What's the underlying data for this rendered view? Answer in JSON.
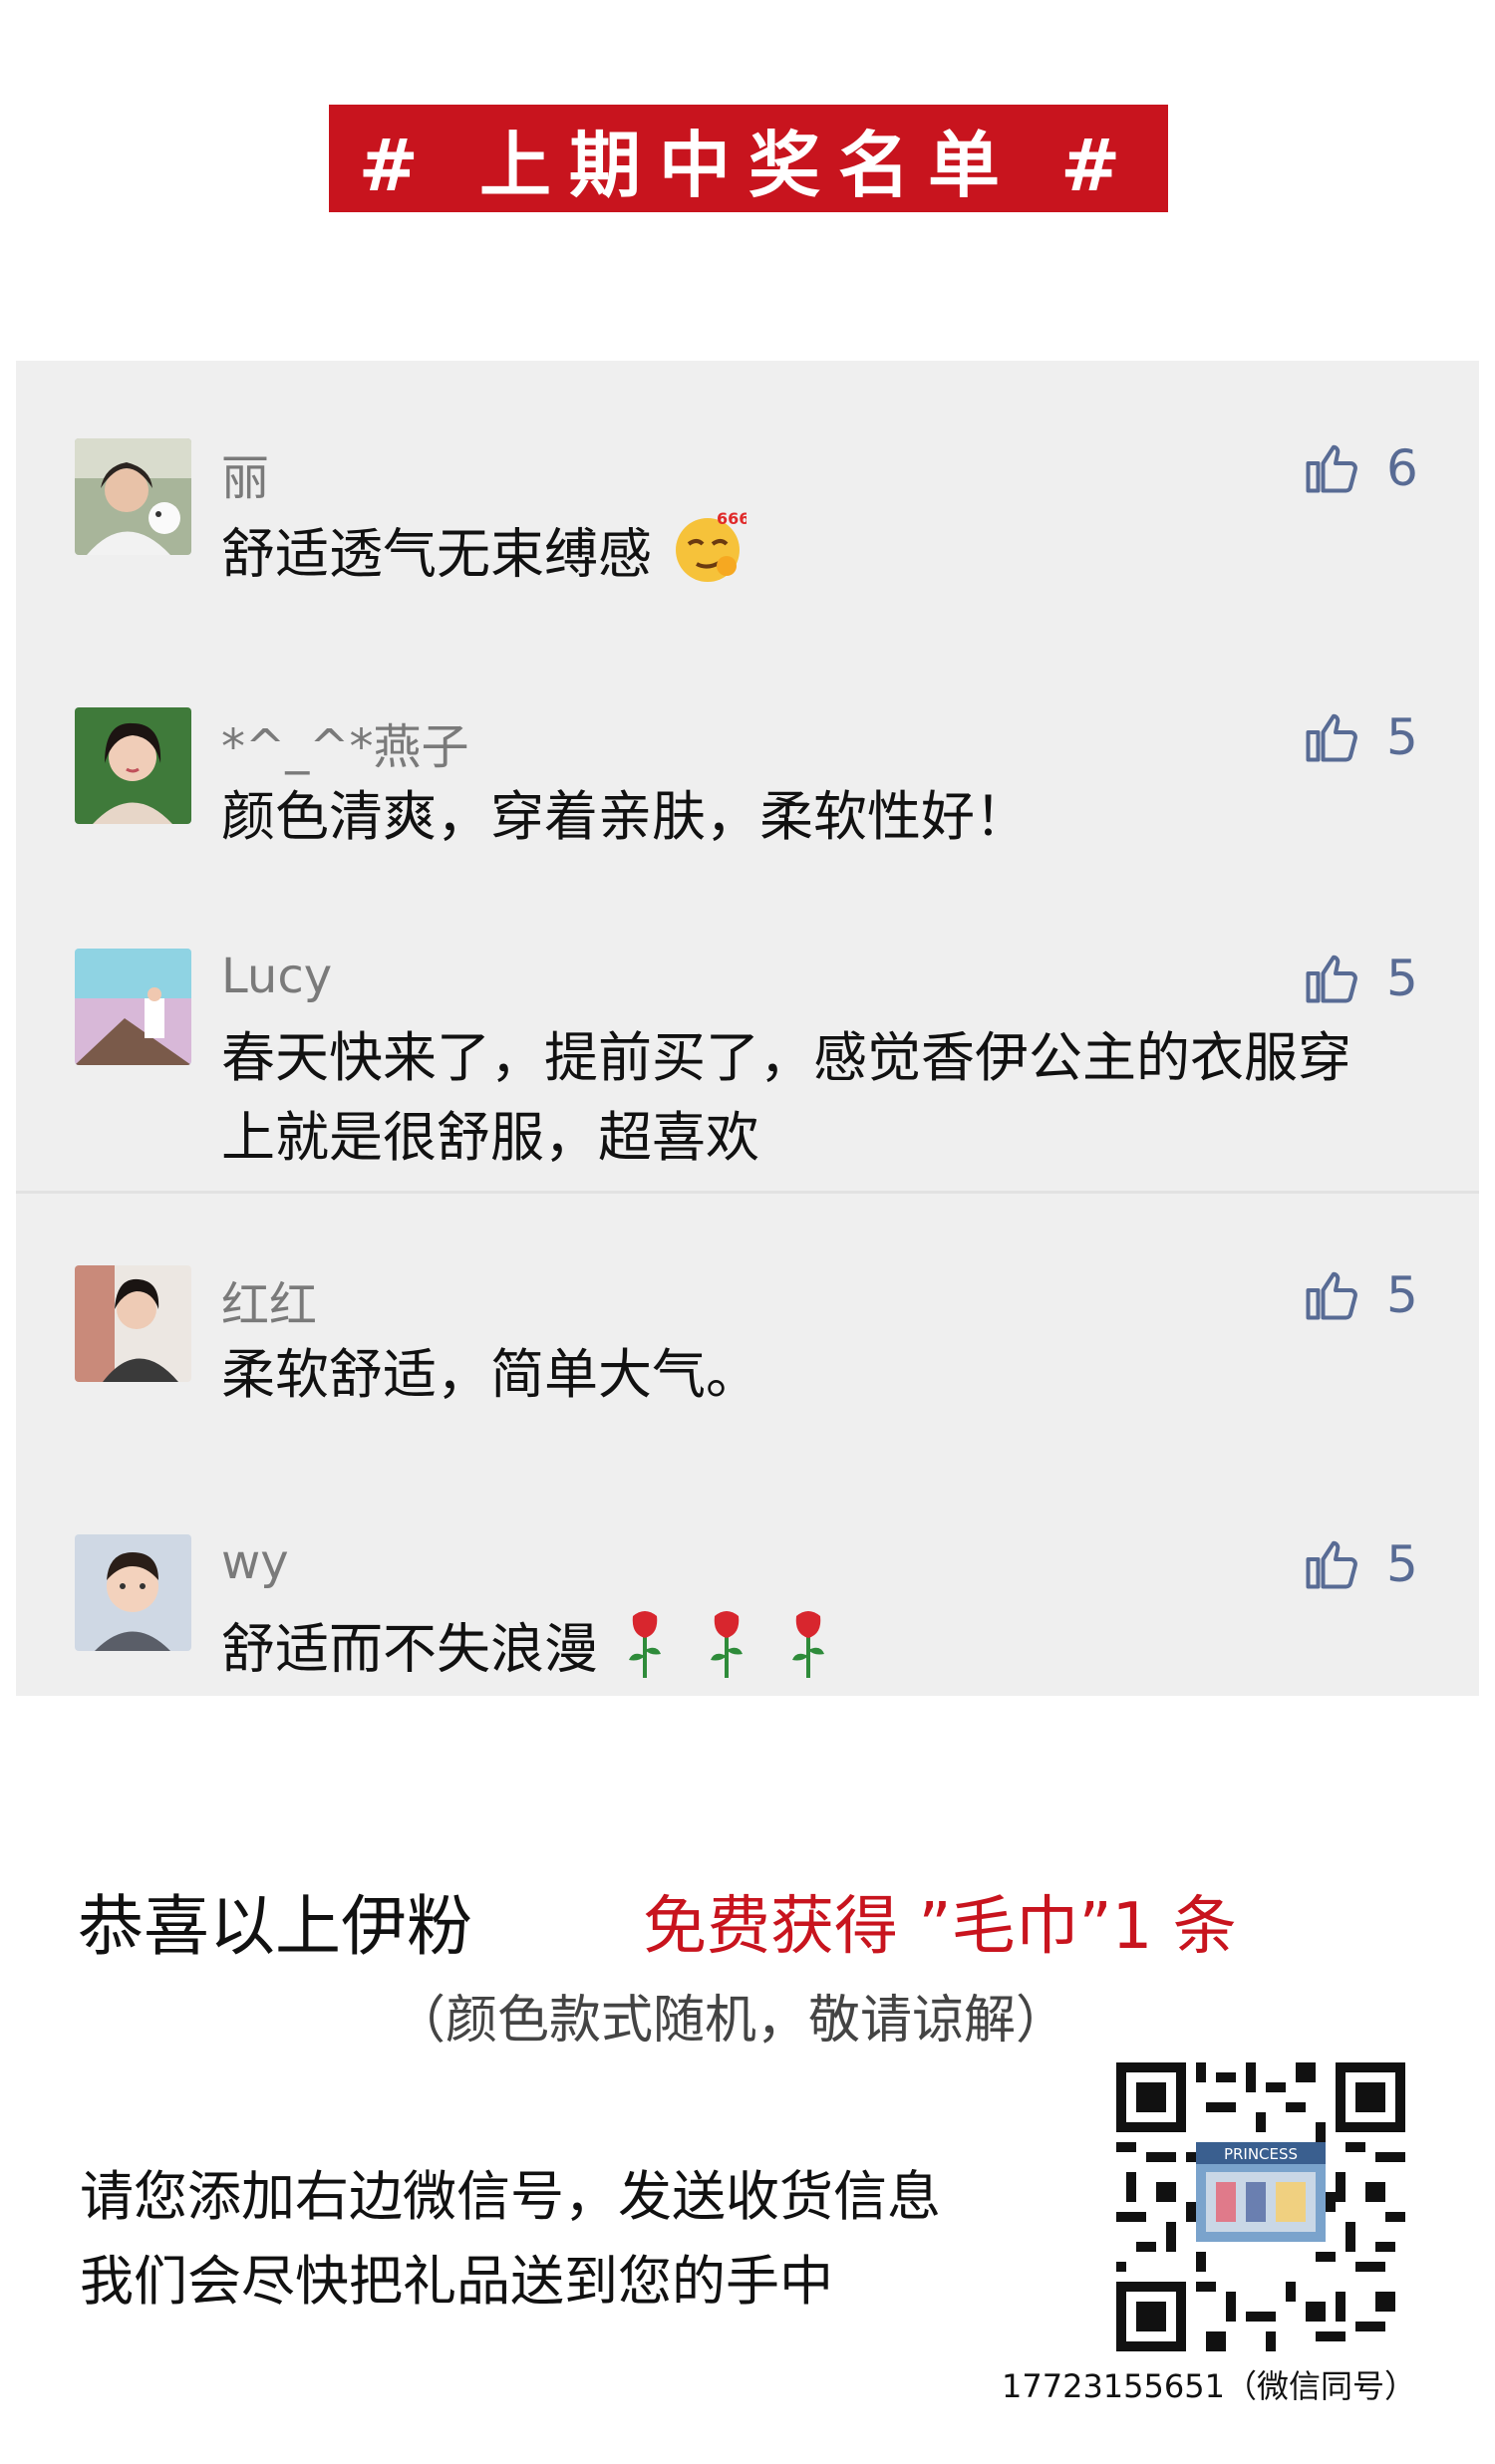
{
  "banner": {
    "title": "# 上期中奖名单 #"
  },
  "comments": [
    {
      "nickname": "丽",
      "content": "舒适透气无束缚感",
      "likes": "6",
      "emoji": "666-smirk-emoji"
    },
    {
      "nickname": "*^_^*燕子",
      "content": "颜色清爽，穿着亲肤，柔软性好！",
      "likes": "5"
    },
    {
      "nickname": "Lucy",
      "content": "春天快来了，提前买了，感觉香伊公主的衣服穿上就是很舒服，超喜欢",
      "likes": "5"
    },
    {
      "nickname": "红红",
      "content": "柔软舒适，简单大气。",
      "likes": "5"
    },
    {
      "nickname": "wy",
      "content": "舒适而不失浪漫",
      "likes": "5",
      "emoji": "rose-emoji"
    }
  ],
  "footer": {
    "congrats": "恭喜以上伊粉",
    "prize": "免费获得 ”毛巾”1 条",
    "note": "（颜色款式随机，敬请谅解）",
    "instruction_line1": "请您添加右边微信号，发送收货信息",
    "instruction_line2": "我们会尽快把礼品送到您的手中",
    "qr_center_text": "PRINCESS",
    "wechat_id": "17723155651（微信同号）"
  },
  "colors": {
    "brand_red": "#c8141e",
    "panel_bg": "#efefef",
    "like_blue": "#586b94"
  }
}
